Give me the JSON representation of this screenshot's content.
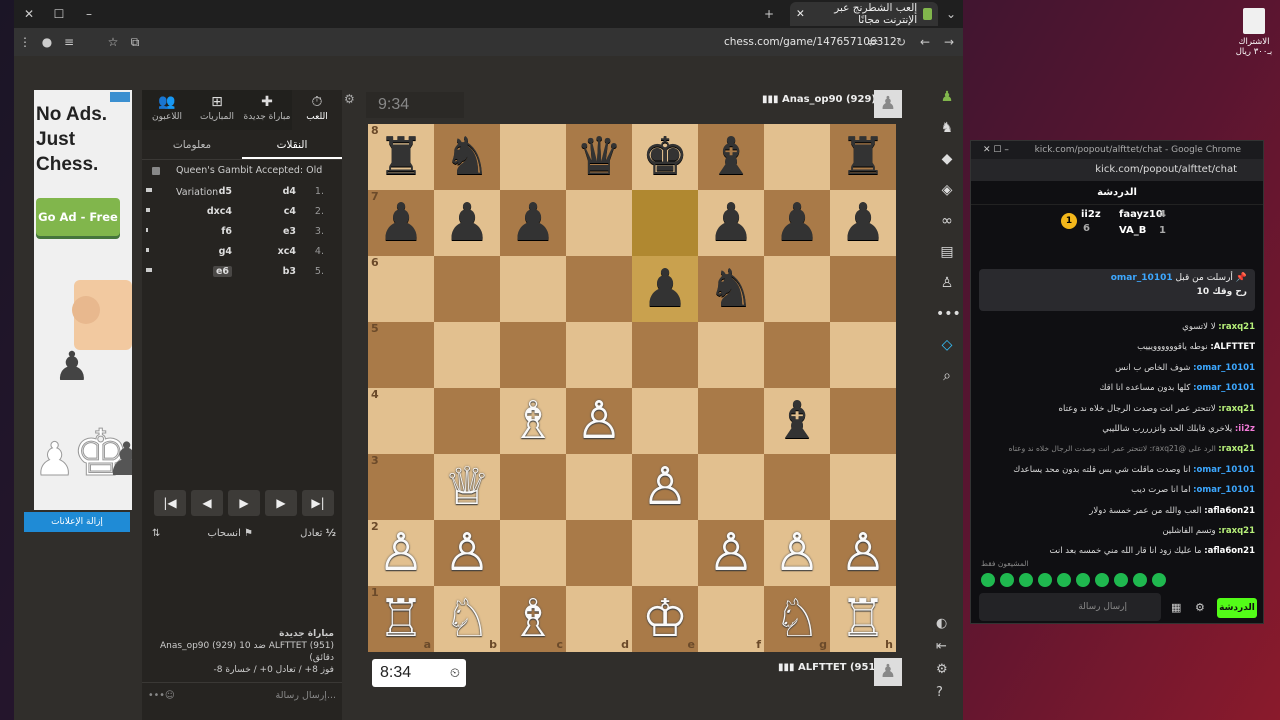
{
  "browser": {
    "tab_title": "إلعب الشطرنج عبر الإنترنت مجانًا",
    "url": "chess.com/game/147657106312"
  },
  "ad": {
    "headline1": "No Ads.",
    "headline2": "Just",
    "headline3": "Chess.",
    "cta": "Go Ad - Free",
    "remove_ads": "إزالة الإعلانات"
  },
  "panel": {
    "tabs": [
      {
        "label": "اللعب",
        "icon": "⏱"
      },
      {
        "label": "مباراة جديدة",
        "icon": "✚"
      },
      {
        "label": "المباريات",
        "icon": "⊞"
      },
      {
        "label": "اللاعبون",
        "icon": "👥"
      }
    ],
    "subtabs": [
      "النقلات",
      "معلومات"
    ],
    "opening": "Queen's Gambit Accepted: Old Variation",
    "moves": [
      {
        "n": "1.",
        "w": "d4",
        "b": "d5"
      },
      {
        "n": "2.",
        "w": "c4",
        "b": "dxc4"
      },
      {
        "n": "3.",
        "w": "e3",
        "b": "f6"
      },
      {
        "n": "4.",
        "w": "xc4",
        "b": "g4"
      },
      {
        "n": "5.",
        "w": "b3",
        "b": "e6"
      }
    ],
    "draw": "تعادل",
    "resign": "انسحاب",
    "half": "½",
    "info_title": "مباراة جديدة",
    "info_line1": "ALFTTET (951) ضد Anas_op90 (929) 10",
    "info_line2": "دقائق)",
    "info_line3": "فوز 8+ / تعادل 0+ / خسارة 8-",
    "chat_placeholder": "إرسال رسالة..."
  },
  "game": {
    "clock_top": "9:34",
    "clock_bottom": "8:34",
    "player_top": "Anas_op90 (929)",
    "player_bottom": "ALFTTET (951)"
  },
  "board": {
    "ranks": [
      "8",
      "7",
      "6",
      "5",
      "4",
      "3",
      "2",
      "1"
    ],
    "files": [
      "a",
      "b",
      "c",
      "d",
      "e",
      "f",
      "g",
      "h"
    ],
    "rows": [
      [
        "♜",
        "♞",
        "",
        "♛",
        "♚",
        "♝",
        "",
        "♜"
      ],
      [
        "♟",
        "♟",
        "♟",
        "",
        "",
        "♟",
        "♟",
        "♟"
      ],
      [
        "",
        "",
        "",
        "",
        "♟",
        "♞",
        "",
        ""
      ],
      [
        "",
        "",
        "",
        "",
        "",
        "",
        "",
        ""
      ],
      [
        "",
        "",
        "♗",
        "♙",
        "",
        "",
        "♝",
        ""
      ],
      [
        "",
        "♕",
        "",
        "",
        "♙",
        "",
        "",
        ""
      ],
      [
        "♙",
        "♙",
        "",
        "",
        "",
        "♙",
        "♙",
        "♙"
      ],
      [
        "♖",
        "♘",
        "♗",
        "",
        "♔",
        "",
        "♘",
        "♖"
      ]
    ],
    "colors": [
      [
        "b",
        "b",
        "",
        "b",
        "b",
        "b",
        "",
        "b"
      ],
      [
        "b",
        "b",
        "b",
        "",
        "",
        "b",
        "b",
        "b"
      ],
      [
        "",
        "",
        "",
        "",
        "b",
        "b",
        "",
        ""
      ],
      [
        "",
        "",
        "",
        "",
        "",
        "",
        "",
        ""
      ],
      [
        "",
        "",
        "w",
        "w",
        "",
        "",
        "b",
        ""
      ],
      [
        "",
        "w",
        "",
        "",
        "w",
        "",
        "",
        ""
      ],
      [
        "w",
        "w",
        "",
        "",
        "",
        "w",
        "w",
        "w"
      ],
      [
        "w",
        "w",
        "w",
        "",
        "w",
        "",
        "w",
        "w"
      ]
    ],
    "highlights": [
      "e7",
      "e6"
    ]
  },
  "kick": {
    "title": "kick.com/popout/alfttet/chat - Google Chrome",
    "url": "kick.com/popout/alfttet/chat",
    "header": "الدردشة",
    "lead1": "faayz10",
    "lead1n": "4",
    "lead2": "ii2z",
    "lead2n": "6",
    "lead3": "VA_B",
    "lead3n": "1",
    "rank": "1",
    "pin_user": "omar_10101",
    "pin_label": "أرسلت من قبل",
    "pin_msg": "رح وقك 10",
    "messages": [
      {
        "u": "raxq21",
        "t": "لا لاتسوي"
      },
      {
        "u": "ALFTTET",
        "t": "نوطه ياقوووووويييب"
      },
      {
        "u": "omar_10101",
        "t": "شوف الخاص ب انس"
      },
      {
        "u": "omar_10101",
        "t": "كلها بدون مساعده انا اقك"
      },
      {
        "u": "raxq21",
        "t": "لاتتحتر عمر انت وصدت الرجال خلاه ند وعتاه"
      },
      {
        "u": "ii2z",
        "t": "يلاخري فابلك الحد وانزرررب شالليبي"
      },
      {
        "u": "raxq21",
        "t": "الرد على @raxq21: لاتتحتر عمر انت وصدت الرجال خلاه ند وعتاه"
      },
      {
        "u": "omar_10101",
        "t": "انا وصدت ماقلت شي بس قلته بدون محد يساعدك"
      },
      {
        "u": "omar_10101",
        "t": "اما انا صرت ديب"
      },
      {
        "u": "afla6on21",
        "t": "العب والله من عمر خمسة دولار"
      },
      {
        "u": "raxq21",
        "t": "وتسم الفاشلين"
      },
      {
        "u": "afla6on21",
        "t": "ما عليك زود انا قار الله مني خمسه بعد انت"
      }
    ],
    "emotes_label": "المشيعون فقط",
    "input_placeholder": "إرسال رسالة",
    "chat_btn": "الدردشة"
  },
  "desktop": {
    "icon_label": "الاشتراك بـ٣٠٠ ريال"
  },
  "colors": {
    "accent": "#81b64c",
    "kick_green": "#53fc18",
    "light_sq": "#e2c08f",
    "dark_sq": "#a97a48"
  }
}
